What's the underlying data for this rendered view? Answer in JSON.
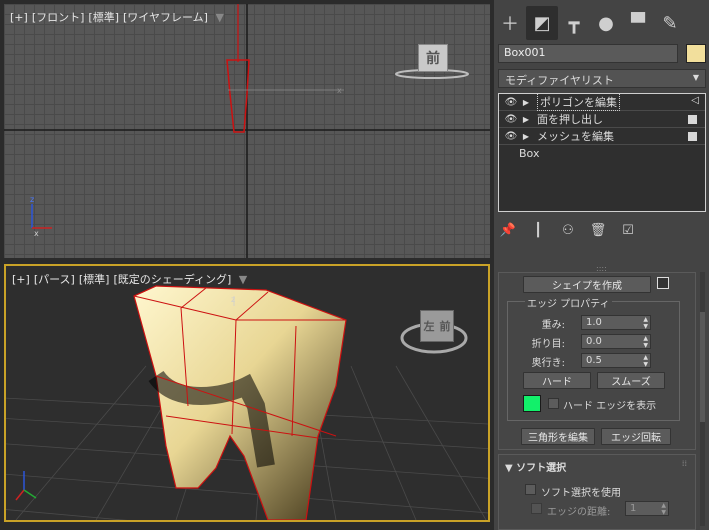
{
  "viewport_top": {
    "label_plus": "[+]",
    "label_view": "[フロント]",
    "label_std": "[標準]",
    "label_shade": "[ワイヤフレーム]",
    "viewcube_face": "前"
  },
  "viewport_bottom": {
    "label_plus": "[+]",
    "label_view": "[パース]",
    "label_std": "[標準]",
    "label_shade": "[既定のシェーディング]",
    "viewcube_face_a": "左",
    "viewcube_face_b": "前"
  },
  "panel": {
    "object_name": "Box001",
    "object_color": "#f2df9c",
    "modifier_list": "モディファイヤリスト",
    "stack": [
      {
        "label": "ポリゴンを編集"
      },
      {
        "label": "面を押し出し"
      },
      {
        "label": "メッシュを編集"
      }
    ],
    "stack_base": "Box",
    "rollout": {
      "make_shape": "シェイプを作成",
      "group_title": "エッジ プロパティ",
      "weight_label": "重み:",
      "weight_value": "1.0",
      "crease_label": "折り目:",
      "crease_value": "0.0",
      "depth_label": "奥行き:",
      "depth_value": "0.5",
      "hard_button": "ハード",
      "smooth_button": "スムーズ",
      "edge_color": "#12f06a",
      "show_hard_edges": "ハード エッジを表示",
      "edit_tri_button": "三角形を編集",
      "turn_edge_button": "エッジ回転"
    },
    "soft": {
      "title": "ソフト選択",
      "use_soft": "ソフト選択を使用",
      "edge_distance": "エッジの距離:",
      "edge_distance_value": "1"
    }
  }
}
